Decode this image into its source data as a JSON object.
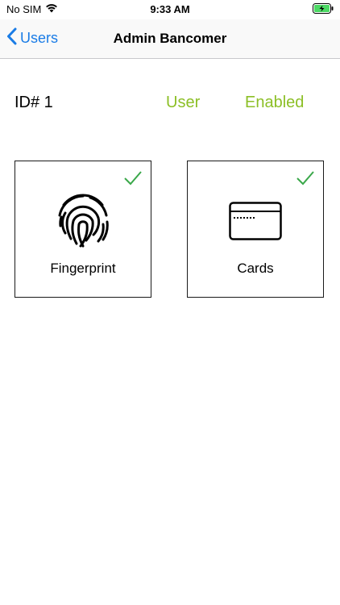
{
  "status_bar": {
    "carrier": "No SIM",
    "time": "9:33 AM",
    "battery": "charging"
  },
  "nav": {
    "back_label": "Users",
    "title": "Admin Bancomer"
  },
  "user": {
    "id_label": "ID# 1",
    "role": "User",
    "status": "Enabled"
  },
  "tiles": [
    {
      "label": "Fingerprint",
      "icon": "fingerprint-icon",
      "checked": true
    },
    {
      "label": "Cards",
      "icon": "card-icon",
      "checked": true
    }
  ],
  "colors": {
    "accent_blue": "#1a7ce6",
    "status_green": "#8cbf26",
    "check_green": "#3aa84a",
    "battery_green": "#4cd964"
  }
}
